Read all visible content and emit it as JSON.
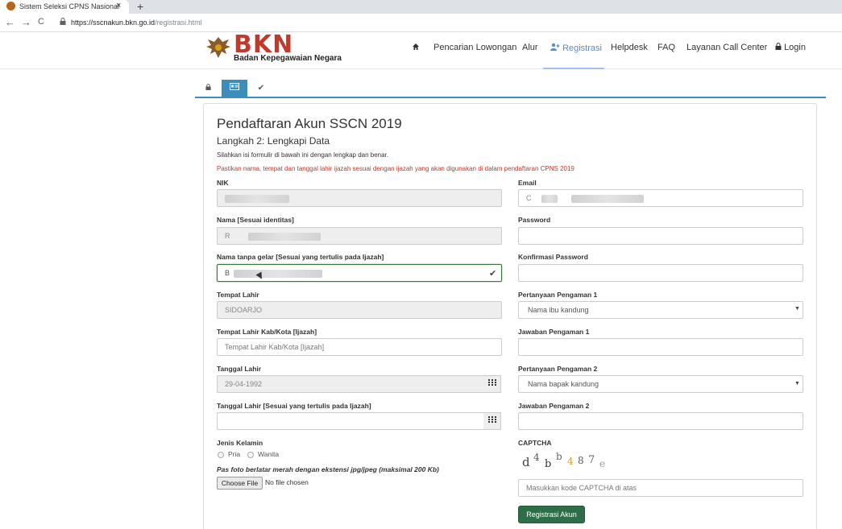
{
  "browser": {
    "tab_title": "Sistem Seleksi CPNS Nasional",
    "tab_close": "×",
    "new_tab": "+",
    "back": "←",
    "forward": "→",
    "reload": "C",
    "url_host": "https://sscnakun.bkn.go.id",
    "url_path": "/registrasi.html"
  },
  "header": {
    "logo_text": "BKN",
    "logo_sub": "Badan Kepegawaian Negara",
    "menu": [
      {
        "label": "Pencarian Lowongan"
      },
      {
        "label": "Alur"
      },
      {
        "label": "Registrasi"
      },
      {
        "label": "Helpdesk"
      },
      {
        "label": "FAQ"
      },
      {
        "label": "Layanan Call Center"
      },
      {
        "label": "Login"
      }
    ]
  },
  "form": {
    "title": "Pendaftaran Akun SSCN 2019",
    "step": "Langkah 2: Lengkapi Data",
    "info": "Silahkan isi formulir di bawah ini dengan lengkap dan benar.",
    "warning": "Pastikan nama, tempat dan tanggal lahir ijazah sesuai dengan ijazah yang akan digunakan di dalam pendaftaran CPNS 2019",
    "left": {
      "nik_label": "NIK",
      "nama_label": "Nama [Sesuai identitas]",
      "nama_value": "R",
      "nama_gelar_label": "Nama tanpa gelar [Sesuai yang tertulis pada Ijazah]",
      "nama_gelar_value": "B",
      "tempat_lahir_label": "Tempat Lahir",
      "tempat_lahir_value": "SIDOARJO",
      "tempat_ijazah_label": "Tempat Lahir Kab/Kota [Ijazah]",
      "tempat_ijazah_placeholder": "Tempat Lahir Kab/Kota [Ijazah]",
      "tanggal_lahir_label": "Tanggal Lahir",
      "tanggal_lahir_value": "29-04-1992",
      "tanggal_ijazah_label": "Tanggal Lahir [Sesuai yang tertulis pada Ijazah]",
      "gender_label": "Jenis Kelamin",
      "gender_options": [
        "Pria",
        "Wanita"
      ],
      "photo_note": "Pas foto berlatar merah dengan ekstensi jpg/jpeg (maksimal 200 Kb)",
      "file_button": "Choose File",
      "file_status": "No file chosen"
    },
    "right": {
      "email_label": "Email",
      "email_value": "C",
      "password_label": "Password",
      "confirm_label": "Konfirmasi Password",
      "q1_label": "Pertanyaan Pengaman 1",
      "q1_value": "Nama ibu kandung",
      "a1_label": "Jawaban Pengaman 1",
      "q2_label": "Pertanyaan Pengaman 2",
      "q2_value": "Nama bapak kandung",
      "a2_label": "Jawaban Pengaman 2",
      "captcha_label": "CAPTCHA",
      "captcha_chars": [
        "d",
        "4",
        "b",
        "b",
        "4",
        "8",
        "7",
        "e"
      ],
      "captcha_placeholder": "Masukkan kode CAPTCHA di atas",
      "submit": "Registrasi Akun"
    }
  },
  "colors": {
    "brand_red": "#c0392b",
    "active_blue": "#3c8dbc",
    "submit_green": "#2e6e47",
    "warning_red": "#c0392b"
  },
  "icons": {
    "home": "home-icon",
    "user_plus": "user-plus-icon",
    "lock": "lock-icon",
    "calendar": "calendar-icon",
    "check": "check-icon"
  }
}
